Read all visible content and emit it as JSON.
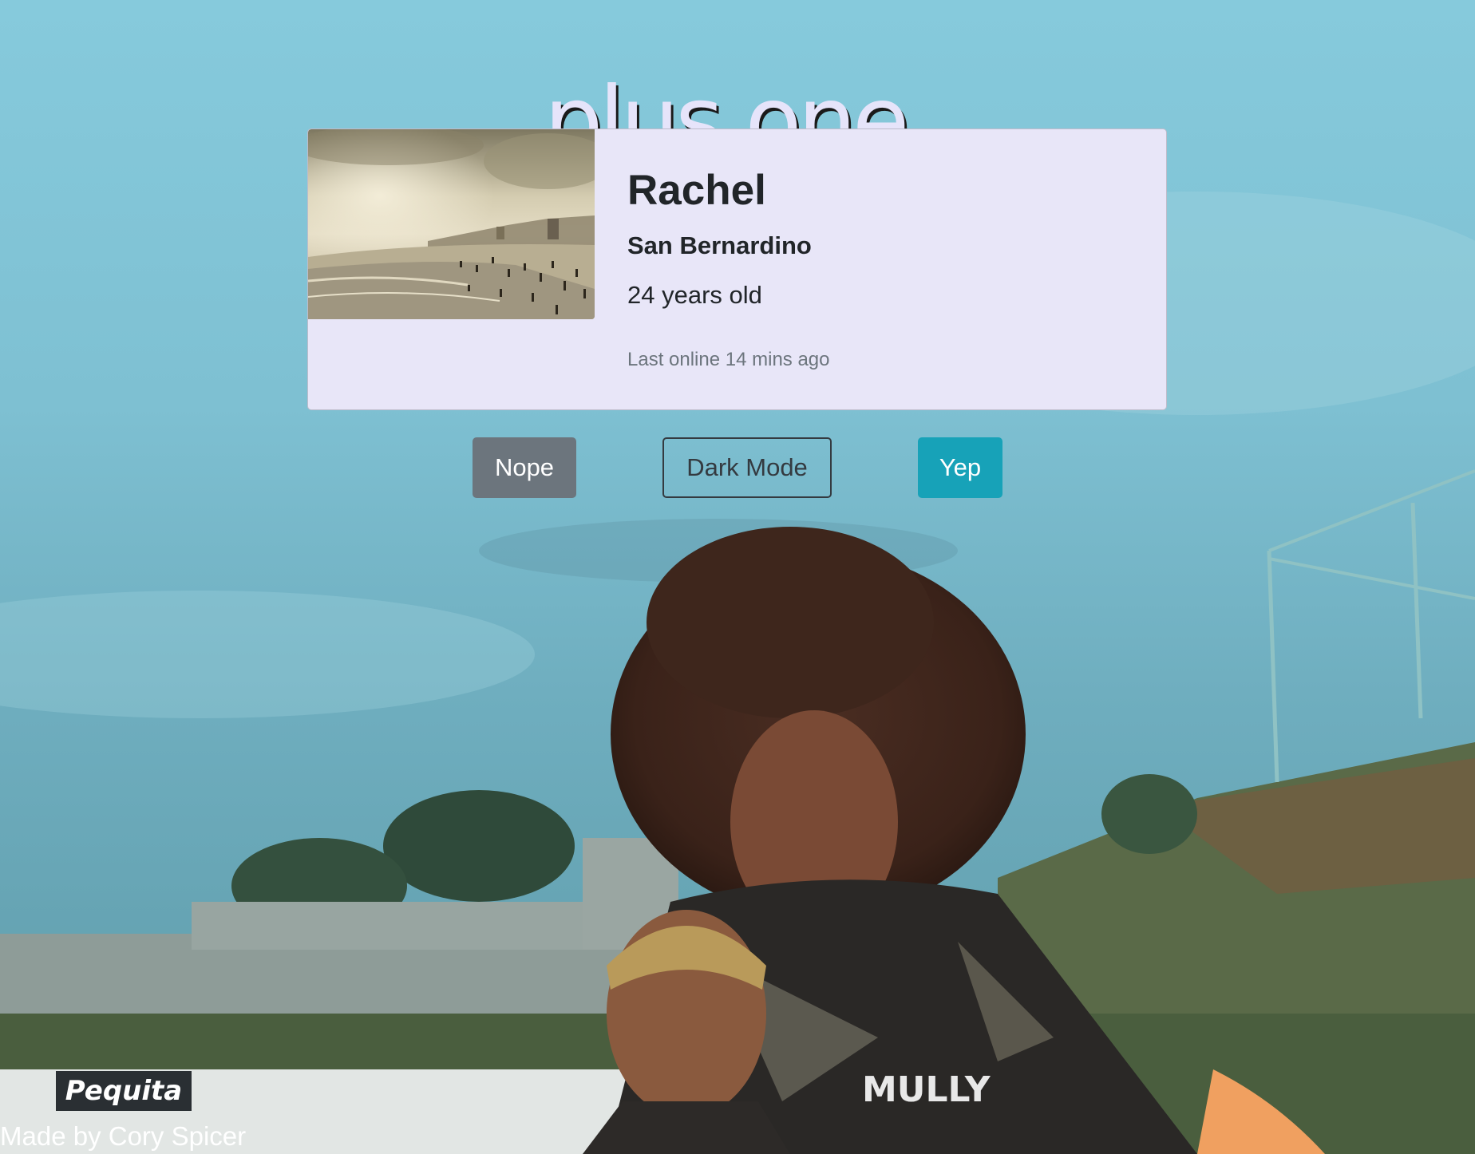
{
  "app": {
    "title": "plus one."
  },
  "profile": {
    "name": "Rachel",
    "location": "San Bernardino",
    "age": "24 years old",
    "last_online": "Last online 14 mins ago",
    "photo": "beach-photo"
  },
  "actions": {
    "nope_label": "Nope",
    "dark_mode_label": "Dark Mode",
    "yep_label": "Yep"
  },
  "footer": {
    "credit": "Made by Cory Spicer"
  },
  "background": {
    "sign_text": "Pequita",
    "shirt_text": "MULLY"
  },
  "colors": {
    "card_bg": "#e8e6f8",
    "title_color": "#e6e4fa",
    "nope_bg": "#6c757d",
    "yep_bg": "#17a2b8",
    "dark_outline": "#343a40"
  }
}
